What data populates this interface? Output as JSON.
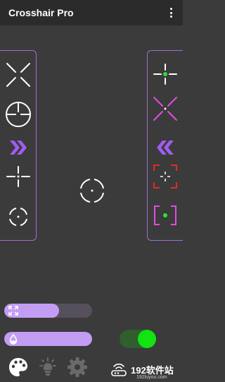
{
  "app_bar": {
    "title": "Crosshair Pro",
    "menu_icon": "more-vert-icon"
  },
  "left_panel": {
    "items": [
      {
        "name": "x-cross",
        "selected": false
      },
      {
        "name": "scope-circle",
        "selected": false
      },
      {
        "name": "double-chevron-right",
        "color": "#a05cf0",
        "selected": false
      },
      {
        "name": "gap-plus",
        "selected": false
      },
      {
        "name": "circle-ticks",
        "selected": false
      }
    ]
  },
  "right_panel": {
    "items": [
      {
        "name": "gap-plus-green-dot",
        "dot_color": "#33dd33"
      },
      {
        "name": "x-cross-magenta",
        "color": "#e34be3"
      },
      {
        "name": "double-chevron-left",
        "color": "#a05cf0"
      },
      {
        "name": "corner-brackets-red",
        "color": "#e02a2a"
      },
      {
        "name": "brackets-magenta-green-dot",
        "color": "#e34be3",
        "dot_color": "#33dd33"
      }
    ]
  },
  "preview": {
    "name": "circle-ticks-crosshair",
    "color": "#ffffff"
  },
  "size_slider": {
    "icon": "expand-icon",
    "value_fraction": 0.62
  },
  "opacity_slider": {
    "icon": "water-drop-icon",
    "value_fraction": 1.0
  },
  "visibility_toggle": {
    "on": true,
    "on_color": "#11e411"
  },
  "bottom_nav": [
    {
      "name": "palette-icon",
      "active": true
    },
    {
      "name": "brightness-icon",
      "active": false
    },
    {
      "name": "settings-icon",
      "active": false
    }
  ],
  "watermark": {
    "text": "192软件站",
    "sub": "192luyou.com"
  },
  "colors": {
    "accent": "#9d6fd0",
    "slider_fill": "#c39df3",
    "background": "#3b3b3b",
    "app_bar": "#2b2b2b"
  }
}
